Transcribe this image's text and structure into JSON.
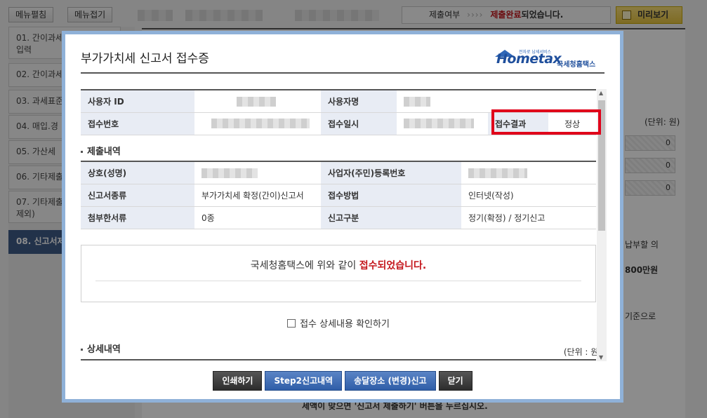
{
  "background": {
    "menu_open_label": "메뉴펼침",
    "menu_close_label": "메뉴접기",
    "status_label": "제출여부",
    "status_arrows": "››››",
    "status_value_red": "제출완료",
    "status_value_rest": "되었습니다.",
    "preview_label": "미리보기",
    "menu_items": [
      {
        "num": "01.",
        "label": "간이과세\n입력"
      },
      {
        "num": "02.",
        "label": "간이과세"
      },
      {
        "num": "03.",
        "label": "과세표준"
      },
      {
        "num": "04.",
        "label": "매입.경"
      },
      {
        "num": "05.",
        "label": "가산세"
      },
      {
        "num": "06.",
        "label": "기타제출"
      },
      {
        "num": "07.",
        "label": "기타제출\n제외)"
      },
      {
        "num": "08.",
        "label": "신고서제"
      }
    ],
    "unit_label": "(단위: 원)",
    "field_values": [
      "0",
      "0",
      "0"
    ],
    "right_text_1": "납부할 의",
    "right_text_2": "800만원",
    "right_text_3": "기준으로",
    "bottom_text": "세액이 맞으면 '신고서 제출하기' 버튼을 누르십시오."
  },
  "modal": {
    "title": "부가가치세 신고서 접수증",
    "logo_text": "Hometax",
    "logo_sub": "국세청홈택스",
    "logo_tiny": "전자로 납세서비스",
    "top_table": {
      "user_id_label": "사용자 ID",
      "user_name_label": "사용자명",
      "receipt_no_label": "접수번호",
      "receipt_date_label": "접수일시",
      "receipt_result_label": "접수결과",
      "receipt_result_value": "정상"
    },
    "submission_section": "제출내역",
    "submission_table": {
      "company_label": "상호(성명)",
      "biz_no_label": "사업자(주민)등록번호",
      "report_type_label": "신고서종류",
      "report_type_value": "부가가치세 확정(간이)신고서",
      "method_label": "접수방법",
      "method_value": "인터넷(작성)",
      "attach_label": "첨부한서류",
      "attach_value": "0종",
      "report_kind_label": "신고구분",
      "report_kind_value": "정기(확정) / 정기신고"
    },
    "message_prefix": "국세청홈택스에 위와 같이 ",
    "message_red": "접수되었습니다.",
    "checkbox_label": "접수 상세내용 확인하기",
    "detail_section": "상세내역",
    "detail_unit": "(단위 : 원)",
    "buttons": {
      "print": "인쇄하기",
      "step2": "Step2신고내역",
      "delivery": "송달장소 (변경)신고",
      "close": "닫기"
    }
  }
}
